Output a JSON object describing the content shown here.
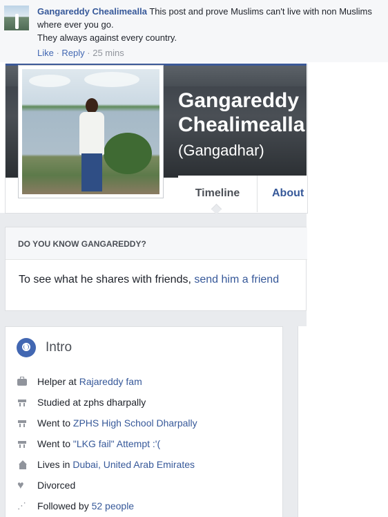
{
  "comment": {
    "author": "Gangareddy Chealimealla",
    "text_line1": " This post and prove Muslims can't live with non Muslims where ever you go.",
    "text_line2": "They always against every country.",
    "like_label": "Like",
    "reply_label": "Reply",
    "separator": " · ",
    "time": "25 mins"
  },
  "profile": {
    "name_line1": "Gangareddy",
    "name_line2": "Chealimealla",
    "alternate_name": "(Gangadhar)",
    "tabs": [
      {
        "label": "Timeline"
      },
      {
        "label": "About"
      }
    ]
  },
  "know_box": {
    "heading": "DO YOU KNOW GANGAREDDY?",
    "prefix": "To see what he shares with friends, ",
    "link": "send him a friend"
  },
  "intro": {
    "title": "Intro",
    "items": [
      {
        "icon": "briefcase-icon",
        "prefix": "Helper at ",
        "link": "Rajareddy fam"
      },
      {
        "icon": "graduation-cap-icon",
        "prefix": "Studied at zphs dharpally",
        "link": ""
      },
      {
        "icon": "graduation-cap-icon",
        "prefix": "Went to ",
        "link": "ZPHS High School Dharpally"
      },
      {
        "icon": "graduation-cap-icon",
        "prefix": "Went to ",
        "link": "\"LKG fail\" Attempt :'("
      },
      {
        "icon": "house-icon",
        "prefix": "Lives in ",
        "link": "Dubai, United Arab Emirates"
      },
      {
        "icon": "heart-icon",
        "prefix": "Divorced",
        "link": ""
      },
      {
        "icon": "rss-icon",
        "prefix": "Followed by ",
        "link": "52 people"
      }
    ]
  },
  "colors": {
    "link": "#365899",
    "page_background": "#e9ebee",
    "brand_blue": "#4267b2"
  }
}
